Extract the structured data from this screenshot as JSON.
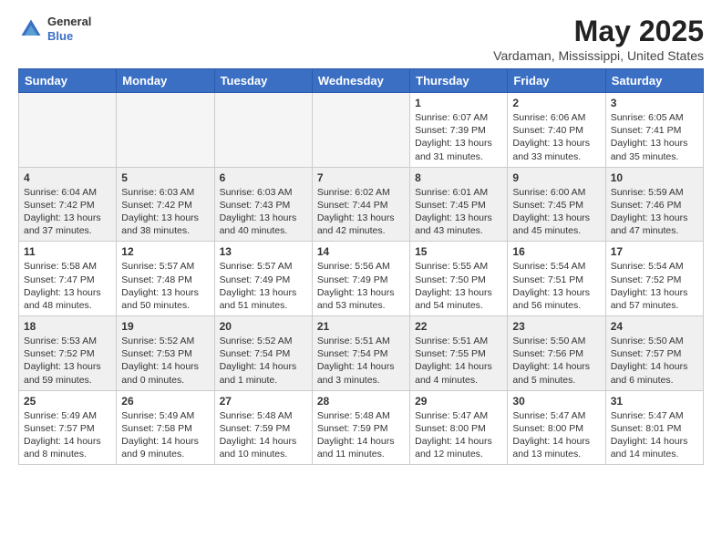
{
  "header": {
    "logo_general": "General",
    "logo_blue": "Blue",
    "month_title": "May 2025",
    "location": "Vardaman, Mississippi, United States"
  },
  "days_of_week": [
    "Sunday",
    "Monday",
    "Tuesday",
    "Wednesday",
    "Thursday",
    "Friday",
    "Saturday"
  ],
  "weeks": [
    [
      {
        "day": "",
        "info": "",
        "empty": true
      },
      {
        "day": "",
        "info": "",
        "empty": true
      },
      {
        "day": "",
        "info": "",
        "empty": true
      },
      {
        "day": "",
        "info": "",
        "empty": true
      },
      {
        "day": "1",
        "info": "Sunrise: 6:07 AM\nSunset: 7:39 PM\nDaylight: 13 hours\nand 31 minutes.",
        "empty": false
      },
      {
        "day": "2",
        "info": "Sunrise: 6:06 AM\nSunset: 7:40 PM\nDaylight: 13 hours\nand 33 minutes.",
        "empty": false
      },
      {
        "day": "3",
        "info": "Sunrise: 6:05 AM\nSunset: 7:41 PM\nDaylight: 13 hours\nand 35 minutes.",
        "empty": false
      }
    ],
    [
      {
        "day": "4",
        "info": "Sunrise: 6:04 AM\nSunset: 7:42 PM\nDaylight: 13 hours\nand 37 minutes.",
        "empty": false
      },
      {
        "day": "5",
        "info": "Sunrise: 6:03 AM\nSunset: 7:42 PM\nDaylight: 13 hours\nand 38 minutes.",
        "empty": false
      },
      {
        "day": "6",
        "info": "Sunrise: 6:03 AM\nSunset: 7:43 PM\nDaylight: 13 hours\nand 40 minutes.",
        "empty": false
      },
      {
        "day": "7",
        "info": "Sunrise: 6:02 AM\nSunset: 7:44 PM\nDaylight: 13 hours\nand 42 minutes.",
        "empty": false
      },
      {
        "day": "8",
        "info": "Sunrise: 6:01 AM\nSunset: 7:45 PM\nDaylight: 13 hours\nand 43 minutes.",
        "empty": false
      },
      {
        "day": "9",
        "info": "Sunrise: 6:00 AM\nSunset: 7:45 PM\nDaylight: 13 hours\nand 45 minutes.",
        "empty": false
      },
      {
        "day": "10",
        "info": "Sunrise: 5:59 AM\nSunset: 7:46 PM\nDaylight: 13 hours\nand 47 minutes.",
        "empty": false
      }
    ],
    [
      {
        "day": "11",
        "info": "Sunrise: 5:58 AM\nSunset: 7:47 PM\nDaylight: 13 hours\nand 48 minutes.",
        "empty": false
      },
      {
        "day": "12",
        "info": "Sunrise: 5:57 AM\nSunset: 7:48 PM\nDaylight: 13 hours\nand 50 minutes.",
        "empty": false
      },
      {
        "day": "13",
        "info": "Sunrise: 5:57 AM\nSunset: 7:49 PM\nDaylight: 13 hours\nand 51 minutes.",
        "empty": false
      },
      {
        "day": "14",
        "info": "Sunrise: 5:56 AM\nSunset: 7:49 PM\nDaylight: 13 hours\nand 53 minutes.",
        "empty": false
      },
      {
        "day": "15",
        "info": "Sunrise: 5:55 AM\nSunset: 7:50 PM\nDaylight: 13 hours\nand 54 minutes.",
        "empty": false
      },
      {
        "day": "16",
        "info": "Sunrise: 5:54 AM\nSunset: 7:51 PM\nDaylight: 13 hours\nand 56 minutes.",
        "empty": false
      },
      {
        "day": "17",
        "info": "Sunrise: 5:54 AM\nSunset: 7:52 PM\nDaylight: 13 hours\nand 57 minutes.",
        "empty": false
      }
    ],
    [
      {
        "day": "18",
        "info": "Sunrise: 5:53 AM\nSunset: 7:52 PM\nDaylight: 13 hours\nand 59 minutes.",
        "empty": false
      },
      {
        "day": "19",
        "info": "Sunrise: 5:52 AM\nSunset: 7:53 PM\nDaylight: 14 hours\nand 0 minutes.",
        "empty": false
      },
      {
        "day": "20",
        "info": "Sunrise: 5:52 AM\nSunset: 7:54 PM\nDaylight: 14 hours\nand 1 minute.",
        "empty": false
      },
      {
        "day": "21",
        "info": "Sunrise: 5:51 AM\nSunset: 7:54 PM\nDaylight: 14 hours\nand 3 minutes.",
        "empty": false
      },
      {
        "day": "22",
        "info": "Sunrise: 5:51 AM\nSunset: 7:55 PM\nDaylight: 14 hours\nand 4 minutes.",
        "empty": false
      },
      {
        "day": "23",
        "info": "Sunrise: 5:50 AM\nSunset: 7:56 PM\nDaylight: 14 hours\nand 5 minutes.",
        "empty": false
      },
      {
        "day": "24",
        "info": "Sunrise: 5:50 AM\nSunset: 7:57 PM\nDaylight: 14 hours\nand 6 minutes.",
        "empty": false
      }
    ],
    [
      {
        "day": "25",
        "info": "Sunrise: 5:49 AM\nSunset: 7:57 PM\nDaylight: 14 hours\nand 8 minutes.",
        "empty": false
      },
      {
        "day": "26",
        "info": "Sunrise: 5:49 AM\nSunset: 7:58 PM\nDaylight: 14 hours\nand 9 minutes.",
        "empty": false
      },
      {
        "day": "27",
        "info": "Sunrise: 5:48 AM\nSunset: 7:59 PM\nDaylight: 14 hours\nand 10 minutes.",
        "empty": false
      },
      {
        "day": "28",
        "info": "Sunrise: 5:48 AM\nSunset: 7:59 PM\nDaylight: 14 hours\nand 11 minutes.",
        "empty": false
      },
      {
        "day": "29",
        "info": "Sunrise: 5:47 AM\nSunset: 8:00 PM\nDaylight: 14 hours\nand 12 minutes.",
        "empty": false
      },
      {
        "day": "30",
        "info": "Sunrise: 5:47 AM\nSunset: 8:00 PM\nDaylight: 14 hours\nand 13 minutes.",
        "empty": false
      },
      {
        "day": "31",
        "info": "Sunrise: 5:47 AM\nSunset: 8:01 PM\nDaylight: 14 hours\nand 14 minutes.",
        "empty": false
      }
    ]
  ]
}
